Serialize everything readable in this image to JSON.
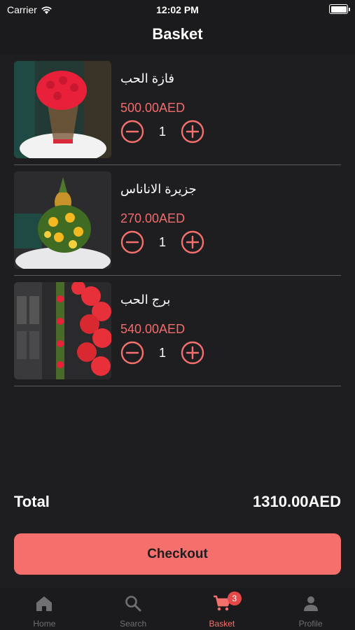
{
  "status_bar": {
    "carrier": "Carrier",
    "time": "12:02 PM"
  },
  "header": {
    "title": "Basket"
  },
  "items": [
    {
      "name": "فازة الحب",
      "price": "500.00AED",
      "quantity": "1"
    },
    {
      "name": "جزيرة الاناناس",
      "price": "270.00AED",
      "quantity": "1"
    },
    {
      "name": "برج الحب",
      "price": "540.00AED",
      "quantity": "1"
    }
  ],
  "summary": {
    "total_label": "Total",
    "total_value": "1310.00AED"
  },
  "checkout": {
    "label": "Checkout"
  },
  "tab_bar": {
    "tabs": [
      {
        "label": "Home",
        "icon": "home-icon"
      },
      {
        "label": "Search",
        "icon": "search-icon"
      },
      {
        "label": "Basket",
        "icon": "cart-icon",
        "badge": "3"
      },
      {
        "label": "Profile",
        "icon": "person-icon"
      }
    ],
    "active": "Basket"
  },
  "colors": {
    "accent": "#f5706d",
    "price": "#f36b6b",
    "background": "#1e1e21",
    "badge": "#e54848"
  }
}
